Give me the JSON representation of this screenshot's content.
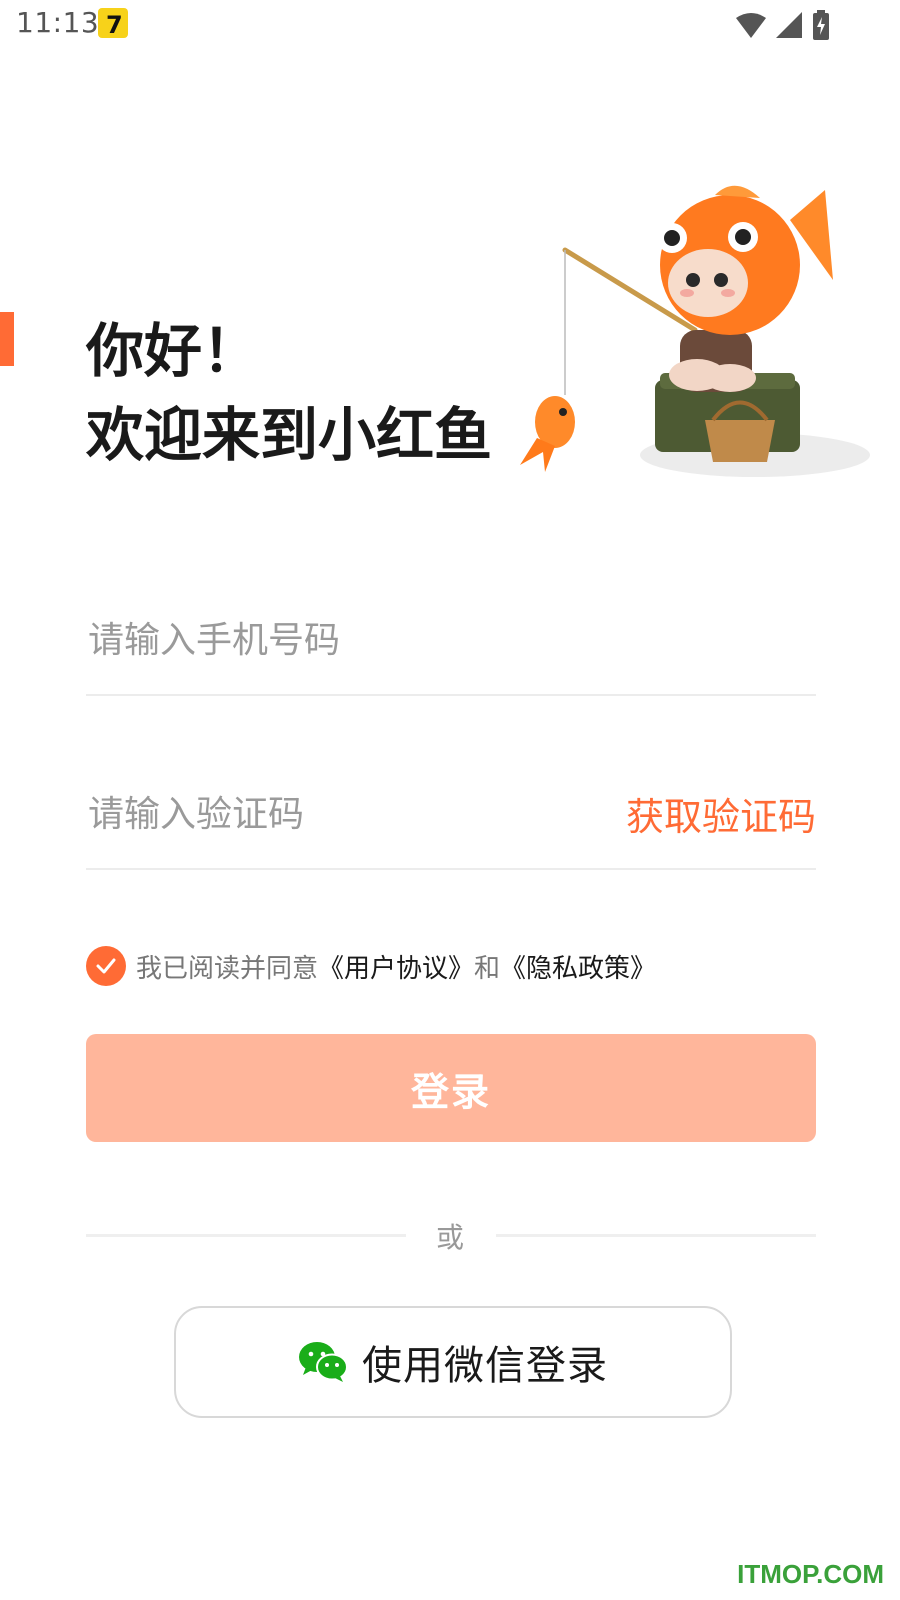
{
  "status_bar": {
    "time": "11:13"
  },
  "greeting": {
    "line1": "你好！",
    "line2": "欢迎来到小红鱼"
  },
  "form": {
    "phone_placeholder": "请输入手机号码",
    "code_placeholder": "请输入验证码",
    "get_code_label": "获取验证码"
  },
  "agreement": {
    "checked": true,
    "prefix": "我已阅读并同意",
    "user_agreement": "《用户协议》",
    "conjunction": "和",
    "privacy_policy": "《隐私政策》"
  },
  "login_button": "登录",
  "divider_text": "或",
  "wechat_button": "使用微信登录",
  "watermark": "ITMOP.COM",
  "colors": {
    "accent": "#ff6b35",
    "login_button_bg": "#ffb69b",
    "wechat_green": "#1aad19"
  }
}
